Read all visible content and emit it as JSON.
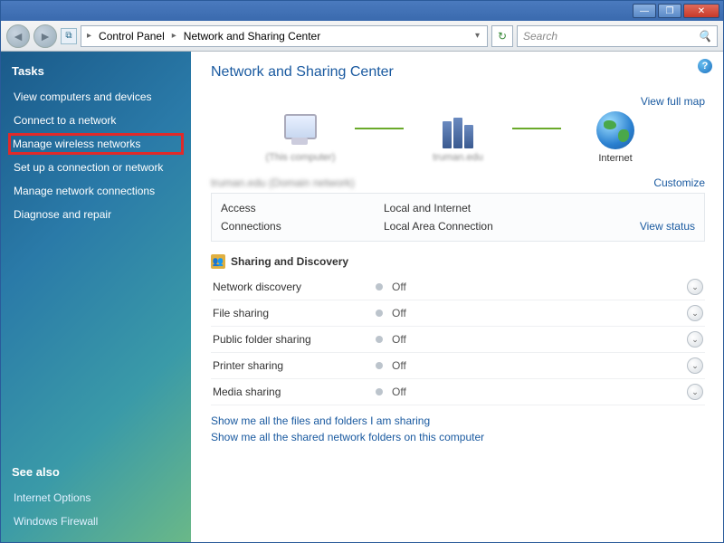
{
  "titlebar": {
    "min": "—",
    "max": "❐",
    "close": "✕"
  },
  "nav": {
    "breadcrumb": [
      "Control Panel",
      "Network and Sharing Center"
    ],
    "search_placeholder": "Search"
  },
  "sidebar": {
    "tasks_header": "Tasks",
    "items": [
      "View computers and devices",
      "Connect to a network",
      "Manage wireless networks",
      "Set up a connection or network",
      "Manage network connections",
      "Diagnose and repair"
    ],
    "see_also_header": "See also",
    "see_also": [
      "Internet Options",
      "Windows Firewall"
    ]
  },
  "main": {
    "title": "Network and Sharing Center",
    "view_full_map": "View full map",
    "diagram": {
      "node1": "(This computer)",
      "node2": "truman.edu",
      "node3": "Internet"
    },
    "network_name": "truman.edu (Domain network)",
    "customize": "Customize",
    "info": [
      {
        "k": "Access",
        "v": "Local and Internet",
        "r": ""
      },
      {
        "k": "Connections",
        "v": "Local Area Connection",
        "r": "View status"
      }
    ],
    "sharing_header": "Sharing and Discovery",
    "sharing": [
      {
        "k": "Network discovery",
        "v": "Off"
      },
      {
        "k": "File sharing",
        "v": "Off"
      },
      {
        "k": "Public folder sharing",
        "v": "Off"
      },
      {
        "k": "Printer sharing",
        "v": "Off"
      },
      {
        "k": "Media sharing",
        "v": "Off"
      }
    ],
    "bottom_links": [
      "Show me all the files and folders I am sharing",
      "Show me all the shared network folders on this computer"
    ]
  }
}
